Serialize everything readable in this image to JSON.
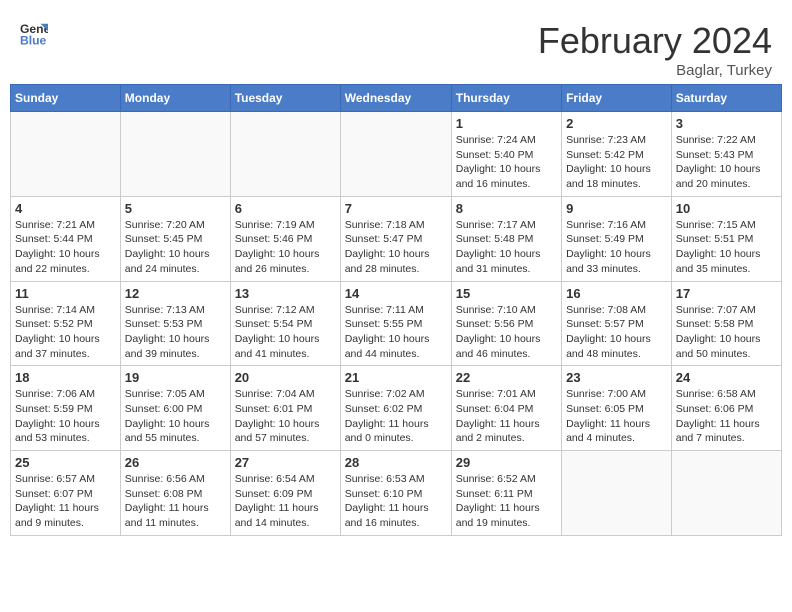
{
  "logo": {
    "line1": "General",
    "line2": "Blue"
  },
  "title": "February 2024",
  "subtitle": "Baglar, Turkey",
  "days_header": [
    "Sunday",
    "Monday",
    "Tuesday",
    "Wednesday",
    "Thursday",
    "Friday",
    "Saturday"
  ],
  "weeks": [
    [
      {
        "day": "",
        "info": ""
      },
      {
        "day": "",
        "info": ""
      },
      {
        "day": "",
        "info": ""
      },
      {
        "day": "",
        "info": ""
      },
      {
        "day": "1",
        "info": "Sunrise: 7:24 AM\nSunset: 5:40 PM\nDaylight: 10 hours\nand 16 minutes."
      },
      {
        "day": "2",
        "info": "Sunrise: 7:23 AM\nSunset: 5:42 PM\nDaylight: 10 hours\nand 18 minutes."
      },
      {
        "day": "3",
        "info": "Sunrise: 7:22 AM\nSunset: 5:43 PM\nDaylight: 10 hours\nand 20 minutes."
      }
    ],
    [
      {
        "day": "4",
        "info": "Sunrise: 7:21 AM\nSunset: 5:44 PM\nDaylight: 10 hours\nand 22 minutes."
      },
      {
        "day": "5",
        "info": "Sunrise: 7:20 AM\nSunset: 5:45 PM\nDaylight: 10 hours\nand 24 minutes."
      },
      {
        "day": "6",
        "info": "Sunrise: 7:19 AM\nSunset: 5:46 PM\nDaylight: 10 hours\nand 26 minutes."
      },
      {
        "day": "7",
        "info": "Sunrise: 7:18 AM\nSunset: 5:47 PM\nDaylight: 10 hours\nand 28 minutes."
      },
      {
        "day": "8",
        "info": "Sunrise: 7:17 AM\nSunset: 5:48 PM\nDaylight: 10 hours\nand 31 minutes."
      },
      {
        "day": "9",
        "info": "Sunrise: 7:16 AM\nSunset: 5:49 PM\nDaylight: 10 hours\nand 33 minutes."
      },
      {
        "day": "10",
        "info": "Sunrise: 7:15 AM\nSunset: 5:51 PM\nDaylight: 10 hours\nand 35 minutes."
      }
    ],
    [
      {
        "day": "11",
        "info": "Sunrise: 7:14 AM\nSunset: 5:52 PM\nDaylight: 10 hours\nand 37 minutes."
      },
      {
        "day": "12",
        "info": "Sunrise: 7:13 AM\nSunset: 5:53 PM\nDaylight: 10 hours\nand 39 minutes."
      },
      {
        "day": "13",
        "info": "Sunrise: 7:12 AM\nSunset: 5:54 PM\nDaylight: 10 hours\nand 41 minutes."
      },
      {
        "day": "14",
        "info": "Sunrise: 7:11 AM\nSunset: 5:55 PM\nDaylight: 10 hours\nand 44 minutes."
      },
      {
        "day": "15",
        "info": "Sunrise: 7:10 AM\nSunset: 5:56 PM\nDaylight: 10 hours\nand 46 minutes."
      },
      {
        "day": "16",
        "info": "Sunrise: 7:08 AM\nSunset: 5:57 PM\nDaylight: 10 hours\nand 48 minutes."
      },
      {
        "day": "17",
        "info": "Sunrise: 7:07 AM\nSunset: 5:58 PM\nDaylight: 10 hours\nand 50 minutes."
      }
    ],
    [
      {
        "day": "18",
        "info": "Sunrise: 7:06 AM\nSunset: 5:59 PM\nDaylight: 10 hours\nand 53 minutes."
      },
      {
        "day": "19",
        "info": "Sunrise: 7:05 AM\nSunset: 6:00 PM\nDaylight: 10 hours\nand 55 minutes."
      },
      {
        "day": "20",
        "info": "Sunrise: 7:04 AM\nSunset: 6:01 PM\nDaylight: 10 hours\nand 57 minutes."
      },
      {
        "day": "21",
        "info": "Sunrise: 7:02 AM\nSunset: 6:02 PM\nDaylight: 11 hours\nand 0 minutes."
      },
      {
        "day": "22",
        "info": "Sunrise: 7:01 AM\nSunset: 6:04 PM\nDaylight: 11 hours\nand 2 minutes."
      },
      {
        "day": "23",
        "info": "Sunrise: 7:00 AM\nSunset: 6:05 PM\nDaylight: 11 hours\nand 4 minutes."
      },
      {
        "day": "24",
        "info": "Sunrise: 6:58 AM\nSunset: 6:06 PM\nDaylight: 11 hours\nand 7 minutes."
      }
    ],
    [
      {
        "day": "25",
        "info": "Sunrise: 6:57 AM\nSunset: 6:07 PM\nDaylight: 11 hours\nand 9 minutes."
      },
      {
        "day": "26",
        "info": "Sunrise: 6:56 AM\nSunset: 6:08 PM\nDaylight: 11 hours\nand 11 minutes."
      },
      {
        "day": "27",
        "info": "Sunrise: 6:54 AM\nSunset: 6:09 PM\nDaylight: 11 hours\nand 14 minutes."
      },
      {
        "day": "28",
        "info": "Sunrise: 6:53 AM\nSunset: 6:10 PM\nDaylight: 11 hours\nand 16 minutes."
      },
      {
        "day": "29",
        "info": "Sunrise: 6:52 AM\nSunset: 6:11 PM\nDaylight: 11 hours\nand 19 minutes."
      },
      {
        "day": "",
        "info": ""
      },
      {
        "day": "",
        "info": ""
      }
    ]
  ]
}
